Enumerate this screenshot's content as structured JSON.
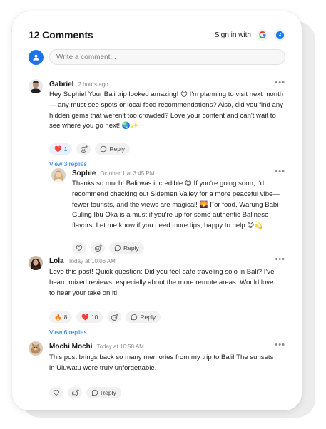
{
  "header": {
    "comments_count": "12 Comments",
    "sign_in_label": "Sign in with"
  },
  "composer": {
    "placeholder": "Write a comment..."
  },
  "colors": {
    "accent": "#1a73e8",
    "reacted_pill": "#eaf1fe",
    "pill": "#f1f1f1"
  },
  "comments": [
    {
      "author": "Gabriel",
      "time": "2 hours ago",
      "text": "Hey Sophie! Your Bali trip looked amazing! 😍 I'm planning to visit next month — any must-see spots or local food recommendations? Also, did you find any hidden gems that weren't too crowded? Love your content and can't wait to see where you go next! 🌏✨",
      "reactions": [
        {
          "emoji": "❤️",
          "count": "1"
        }
      ],
      "reply_label": "Reply",
      "view_replies": "View 3 replies"
    },
    {
      "author": "Sophie",
      "time": "October 1 at 3:45 PM",
      "text": "Thanks so much! Bali was incredible 😍 If you're going soon, I'd recommend checking out Sidemen Valley for a more peaceful vibe—fewer tourists, and the views are magical! 🌄 For food, Warung Babi Guling Ibu Oka is a must if you're up for some authentic Balinese flavors! Let me know if you need more tips, happy to help 😊💫",
      "reply_label": "Reply"
    },
    {
      "author": "Lola",
      "time": "Today at 10:06 AM",
      "text": "Love this post! Quick question: Did you feel safe traveling solo in Bali? I've heard mixed reviews, especially about the more remote areas. Would love to hear your take on it!",
      "reactions": [
        {
          "emoji": "🔥",
          "count": "8"
        },
        {
          "emoji": "❤️",
          "count": "10"
        }
      ],
      "reply_label": "Reply",
      "view_replies": "View 6 replies"
    },
    {
      "author": "Mochi Mochi",
      "time": "Today at 10:58 AM",
      "text": "This post brings back so many memories from my trip to Bali! The sunsets in Uluwatu were truly unforgettable.",
      "reply_label": "Reply"
    }
  ]
}
